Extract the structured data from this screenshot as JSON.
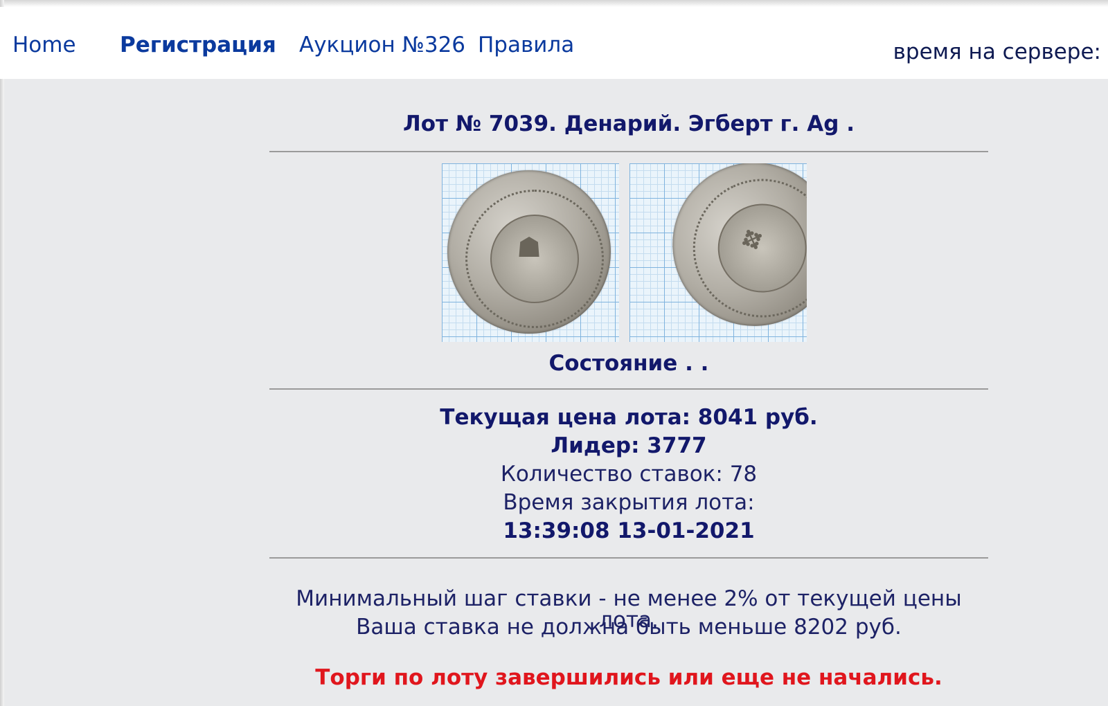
{
  "nav": {
    "home_label": "Home",
    "register_label": "Регистрация",
    "auction_label": "Аукцион №326",
    "rules_label": "Правила",
    "server_time_label": "время на сервере:"
  },
  "lot": {
    "title": "Лот № 7039.  Денарий. Эгберт г.   Ag .",
    "images": {
      "obverse_icon": "coin-obverse-photo",
      "reverse_icon": "coin-reverse-photo"
    },
    "condition": "Состояние . .",
    "current_price": "Текущая цена лота: 8041 руб.",
    "leader": "Лидер: 3777",
    "bids_count": "Количество ставок: 78",
    "close_time_label": "Время закрытия лота:",
    "close_time": "13:39:08 13-01-2021"
  },
  "bidding": {
    "min_step": "Минимальный шаг ставки - не менее 2% от текущей цены лота.",
    "min_bid": "Ваша ставка не должна быть меньше 8202 руб.",
    "notice": "Торги по лоту завершились или еще не начались."
  },
  "colors": {
    "link": "#0b3a9e",
    "text": "#12186b",
    "alert": "#e0161d",
    "background": "#e9eaec"
  }
}
